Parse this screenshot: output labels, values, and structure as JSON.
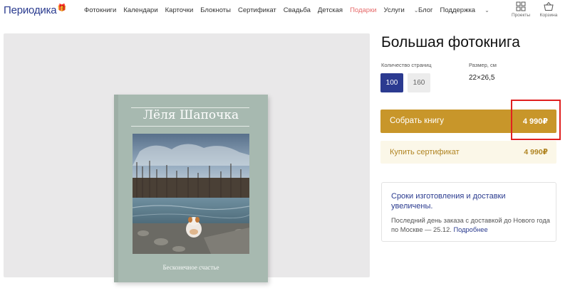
{
  "header": {
    "logo": "Периодика",
    "nav": [
      "Фотокниги",
      "Календари",
      "Карточки",
      "Блокноты",
      "Сертификат",
      "Свадьба",
      "Детская",
      "Подарки",
      "Услуги"
    ],
    "nav_right": [
      "Блог",
      "Поддержка"
    ],
    "projects_label": "Проекты",
    "cart_label": "Корзина",
    "accent_color": "#e66a6a"
  },
  "book": {
    "cover_title": "Лёля Шапочка",
    "cover_subtitle": "Бесконечное счастье"
  },
  "product": {
    "title": "Большая фотокнига",
    "pages_label": "Количество страниц",
    "pages_options": [
      "100",
      "160"
    ],
    "pages_selected": "100",
    "size_label": "Размер, см",
    "size_value": "22×26,5",
    "cta_label": "Собрать книгу",
    "cta_price": "4 990₽",
    "cert_label": "Купить сертификат",
    "cert_price": "4 990₽",
    "accent_color": "#c8962a"
  },
  "notice": {
    "heading": "Сроки изготовления и доставки увеличены.",
    "body": "Последний день заказа с доставкой до Нового года по Москве — 25.12.",
    "link": "Подробнее"
  }
}
